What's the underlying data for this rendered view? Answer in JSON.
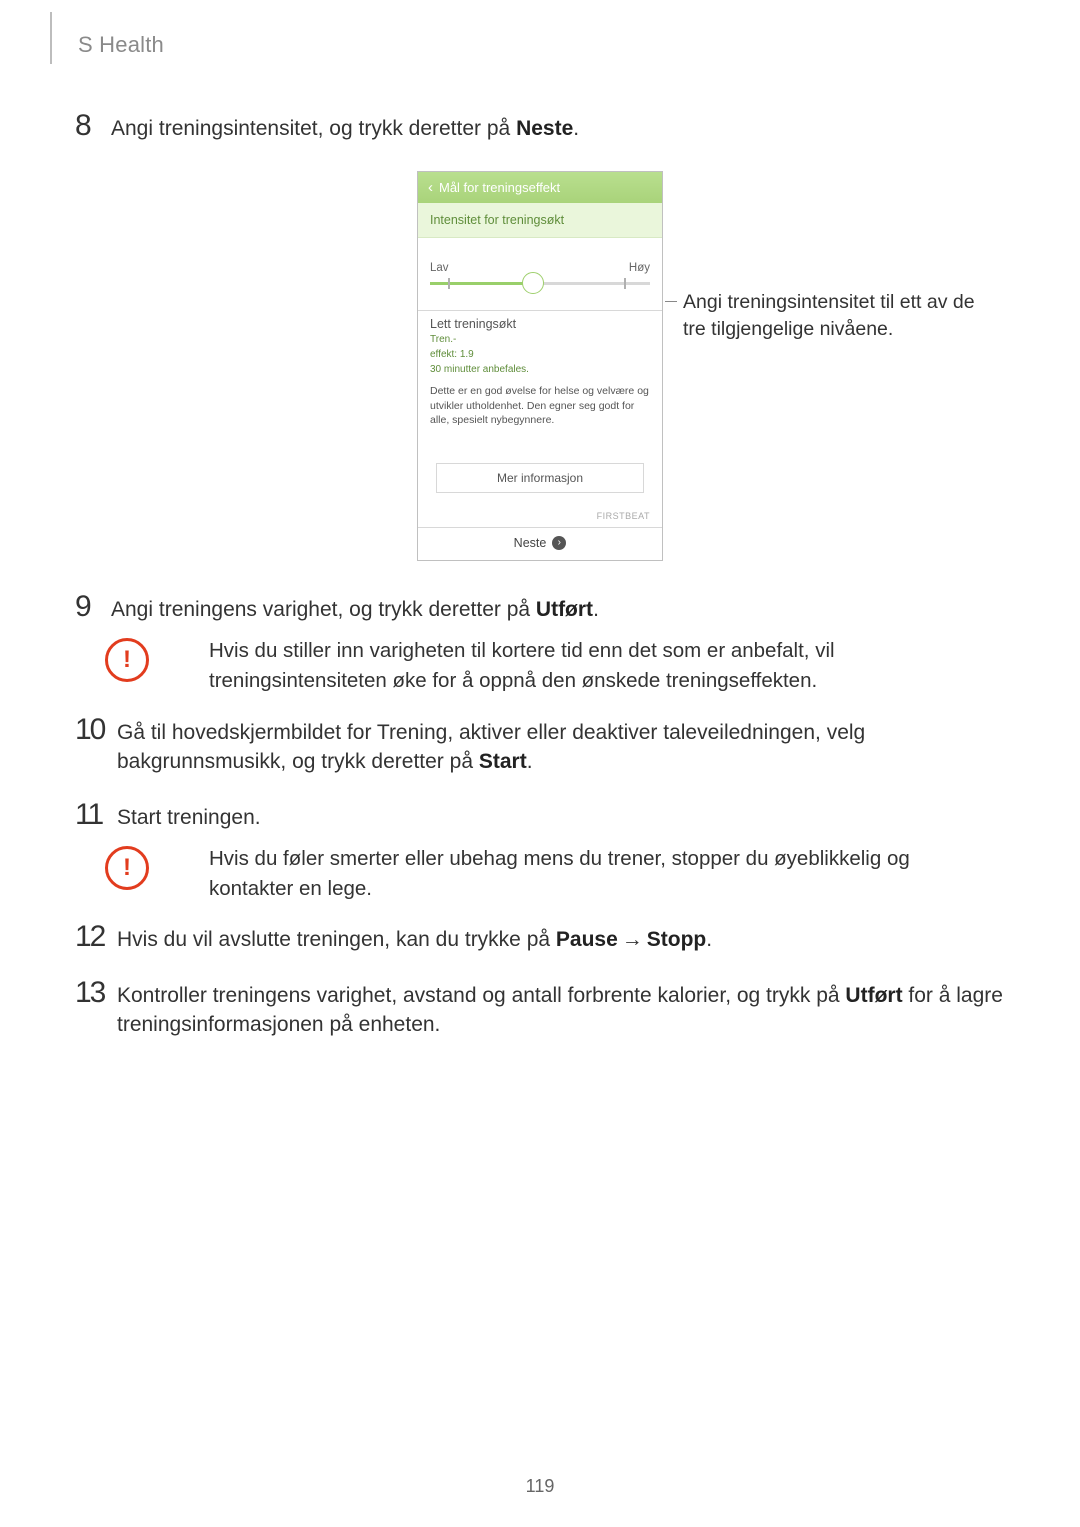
{
  "header": {
    "title": "S Health"
  },
  "figure": {
    "phone": {
      "header_chevron": "‹",
      "header_title": "Mål for treningseffekt",
      "subheader": "Intensitet for treningsøkt",
      "slider_low": "Lav",
      "slider_high": "Høy",
      "level_heading": "Lett treningsøkt",
      "green_line1": "Tren.-",
      "green_line2": "effekt: 1.9",
      "green_line3": "30 minutter anbefales.",
      "description": "Dette er en god øvelse for helse og velvære og utvikler utholdenhet. Den egner seg godt for alle, spesielt nybegynnere.",
      "more_info": "Mer informasjon",
      "brand": "FIRSTBEAT",
      "next": "Neste",
      "next_chevron": "›"
    },
    "annotation": "Angi treningsintensitet til ett av de tre tilgjengelige nivåene."
  },
  "steps": {
    "s8": {
      "num": "8",
      "pre": "Angi treningsintensitet, og trykk deretter på ",
      "bold": "Neste",
      "post": "."
    },
    "s9": {
      "num": "9",
      "pre": "Angi treningens varighet, og trykk deretter på ",
      "bold": "Utført",
      "post": "."
    },
    "caution9": "Hvis du stiller inn varigheten til kortere tid enn det som er anbefalt, vil treningsintensiteten øke for å oppnå den ønskede treningseffekten.",
    "s10": {
      "num": "10",
      "pre": "Gå til hovedskjermbildet for Trening, aktiver eller deaktiver taleveiledningen, velg bakgrunnsmusikk, og trykk deretter på ",
      "bold": "Start",
      "post": "."
    },
    "s11": {
      "num": "11",
      "text": "Start treningen."
    },
    "caution11": "Hvis du føler smerter eller ubehag mens du trener, stopper du øyeblikkelig og kontakter en lege.",
    "s12": {
      "num": "12",
      "pre": "Hvis du vil avslutte treningen, kan du trykke på ",
      "bold1": "Pause",
      "arrow": "→",
      "bold2": "Stopp",
      "post": "."
    },
    "s13": {
      "num": "13",
      "pre": "Kontroller treningens varighet, avstand og antall forbrente kalorier, og trykk på ",
      "bold": "Utført",
      "post": " for å lagre treningsinformasjonen på enheten."
    }
  },
  "page_number": "119"
}
